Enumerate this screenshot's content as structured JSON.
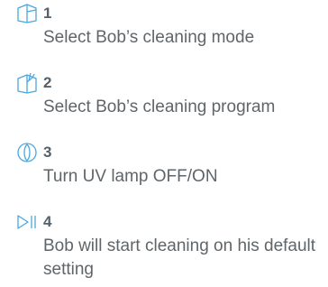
{
  "accent_color": "#4aa7e0",
  "steps": [
    {
      "number": "1",
      "icon": "room-mode-icon",
      "text": "Select Bob’s cleaning mode"
    },
    {
      "number": "2",
      "icon": "program-icon",
      "text": "Select Bob’s cleaning program"
    },
    {
      "number": "3",
      "icon": "uv-lamp-icon",
      "text": "Turn UV lamp OFF/ON"
    },
    {
      "number": "4",
      "icon": "play-pause-icon",
      "text": "Bob will start cleaning on his default setting"
    }
  ]
}
